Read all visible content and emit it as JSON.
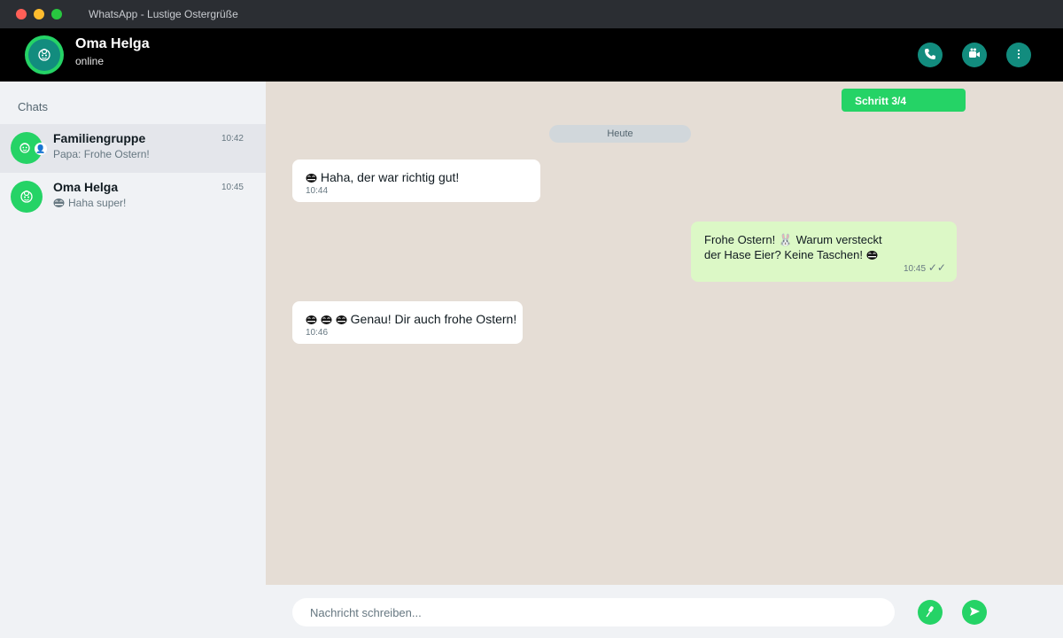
{
  "window": {
    "title": "WhatsApp - Lustige Ostergrüße"
  },
  "header": {
    "contact_name": "Oma Helga",
    "status": "online",
    "avatar_icon": "grandma-avatar-icon",
    "buttons": [
      {
        "name": "call-button",
        "icon": "phone-icon"
      },
      {
        "name": "video-button",
        "icon": "video-icon"
      },
      {
        "name": "menu-button",
        "icon": "more-vertical-icon"
      }
    ]
  },
  "sidebar": {
    "title": "Chats",
    "items": [
      {
        "name": "Familiengruppe",
        "time": "10:42",
        "preview": "Papa: Frohe Ostern!",
        "avatar_icon": "family-group-icon",
        "active": true
      },
      {
        "name": "Oma Helga",
        "time": "10:45",
        "preview": "Haha super!",
        "preview_icon": "laughing-emoji-icon",
        "avatar_icon": "grandma-avatar-icon",
        "active": false
      }
    ]
  },
  "chat": {
    "step": "Schritt 3/4",
    "date_divider": "Heute",
    "messages": [
      {
        "direction": "in",
        "text": "Haha, der war richtig gut!",
        "time": "10:44",
        "emoji_icons": [
          "laughing-emoji-icon"
        ]
      },
      {
        "direction": "out",
        "line1": "Frohe Ostern! 🐰 Warum versteckt",
        "line2": "der Hase Eier? Keine Taschen!",
        "time": "10:45",
        "ticks": "✓✓",
        "emoji_icons": [
          "rabbit-emoji-icon",
          "laughing-emoji-icon"
        ]
      },
      {
        "direction": "in",
        "text": "Genau! Dir auch frohe Ostern!",
        "time": "10:46",
        "emoji_icons": [
          "laughing-emoji-icon",
          "laughing-emoji-icon",
          "laughing-emoji-icon"
        ]
      }
    ]
  },
  "composer": {
    "placeholder": "Nachricht schreiben...",
    "mic_icon": "microphone-icon",
    "send_icon": "send-icon"
  },
  "colors": {
    "accent": "#25d366",
    "teal": "#128c7e",
    "chat_background": "#e5ddd5",
    "outgoing_bubble": "#dcf8c6",
    "header": "#000000"
  }
}
